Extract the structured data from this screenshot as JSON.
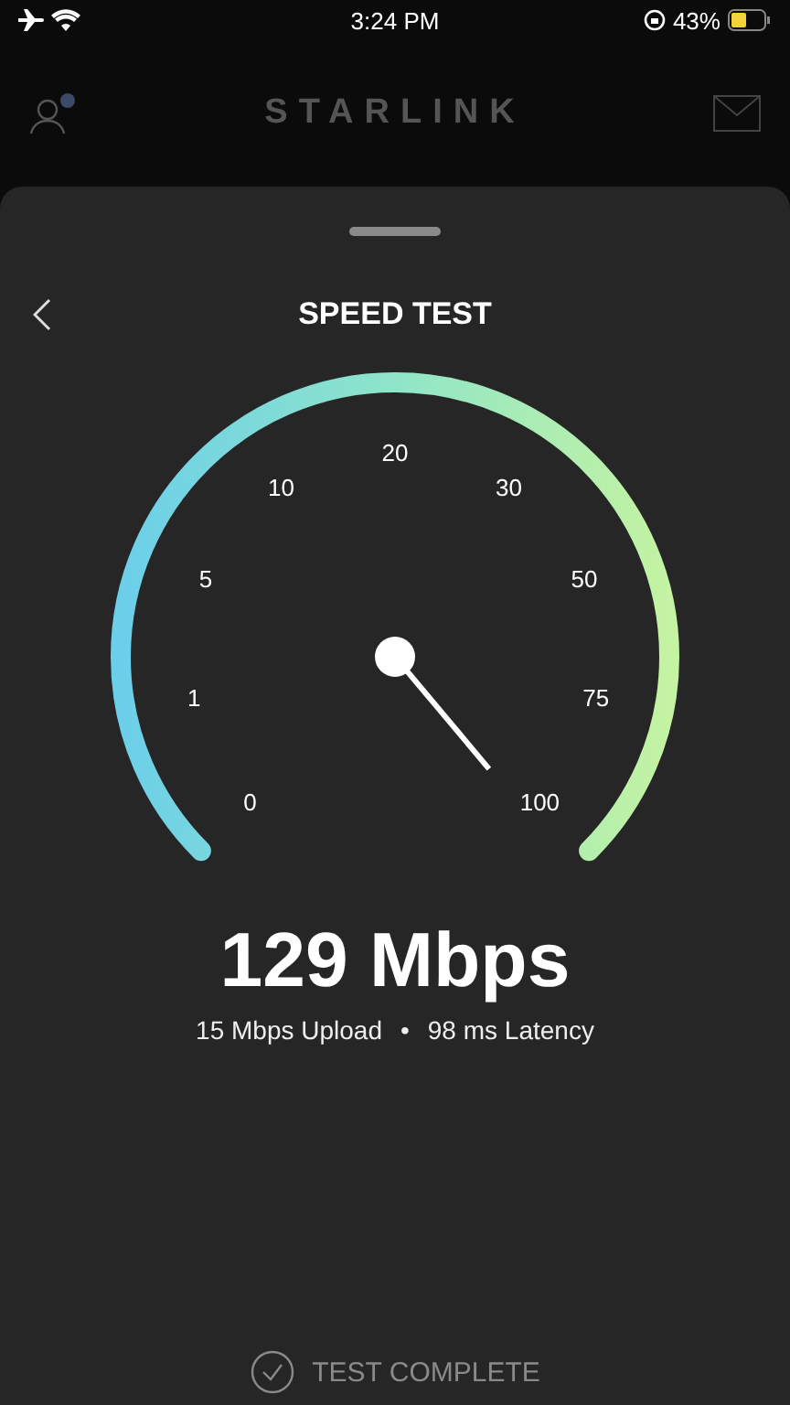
{
  "status_bar": {
    "time": "3:24 PM",
    "battery": "43%"
  },
  "header": {
    "logo": "STARLINK",
    "notification_dot": true
  },
  "sheet": {
    "title": "SPEED TEST"
  },
  "gauge": {
    "ticks": [
      "0",
      "1",
      "5",
      "10",
      "20",
      "30",
      "50",
      "75",
      "100"
    ]
  },
  "result": {
    "speed": "129 Mbps",
    "upload": "15 Mbps Upload",
    "separator": "•",
    "latency": "98 ms Latency"
  },
  "footer": {
    "status": "TEST COMPLETE"
  }
}
